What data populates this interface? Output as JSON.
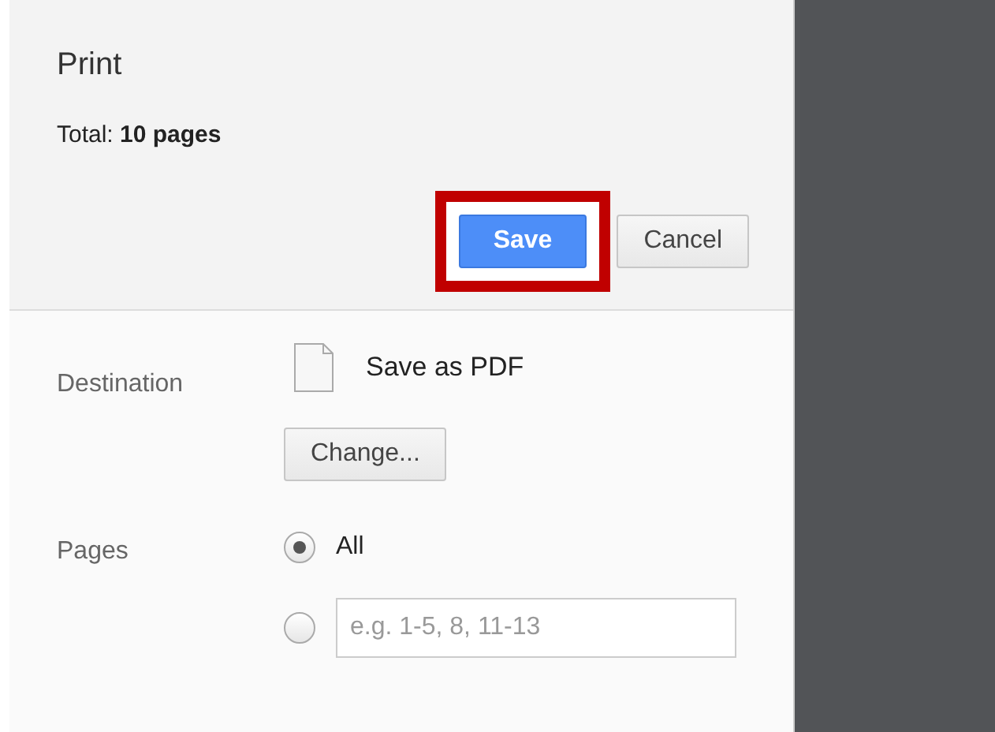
{
  "header": {
    "title": "Print",
    "total_label": "Total:",
    "total_value": "10 pages"
  },
  "buttons": [
    {
      "label": "Save",
      "kind": "primary",
      "highlighted": true
    },
    {
      "label": "Cancel",
      "kind": "normal",
      "highlighted": false
    }
  ],
  "destination": {
    "label": "Destination",
    "name": "Save as PDF",
    "change_button": "Change..."
  },
  "pages": {
    "label": "Pages",
    "options": [
      {
        "kind": "label",
        "text": "All",
        "selected": true
      },
      {
        "kind": "input",
        "placeholder": "e.g. 1-5, 8, 11-13",
        "selected": false
      }
    ]
  }
}
